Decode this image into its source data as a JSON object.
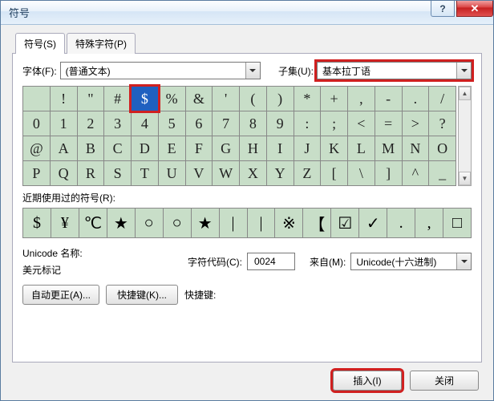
{
  "window": {
    "title": "符号"
  },
  "tabs": {
    "symbols": "符号(S)",
    "special": "特殊字符(P)"
  },
  "font": {
    "label": "字体(F):",
    "value": "(普通文本)"
  },
  "subset": {
    "label": "子集(U):",
    "value": "基本拉丁语"
  },
  "grid_rows": [
    [
      " ",
      "!",
      "\"",
      "#",
      "$",
      "%",
      "&",
      "'",
      "(",
      ")",
      "*",
      "+",
      ",",
      "-",
      ".",
      "/"
    ],
    [
      "0",
      "1",
      "2",
      "3",
      "4",
      "5",
      "6",
      "7",
      "8",
      "9",
      ":",
      ";",
      "<",
      "=",
      ">",
      "?"
    ],
    [
      "@",
      "A",
      "B",
      "C",
      "D",
      "E",
      "F",
      "G",
      "H",
      "I",
      "J",
      "K",
      "L",
      "M",
      "N",
      "O"
    ],
    [
      "P",
      "Q",
      "R",
      "S",
      "T",
      "U",
      "V",
      "W",
      "X",
      "Y",
      "Z",
      "[",
      "\\",
      "]",
      "^",
      "_"
    ]
  ],
  "selected": {
    "row": 0,
    "col": 4
  },
  "recent": {
    "label": "近期使用过的符号(R):",
    "items": [
      "$",
      "¥",
      "℃",
      "★",
      "○",
      "○",
      "★",
      "|",
      "|",
      "※",
      "【",
      "☑",
      "✓",
      ".",
      ",",
      "□"
    ]
  },
  "unicode_name": {
    "label": "Unicode 名称:",
    "value": "美元标记"
  },
  "charcode": {
    "label": "字符代码(C):",
    "value": "0024"
  },
  "from": {
    "label": "来自(M):",
    "value": "Unicode(十六进制)"
  },
  "buttons": {
    "autocorrect": "自动更正(A)...",
    "shortcutkey": "快捷键(K)...",
    "shortcut_label": "快捷键:",
    "shortcut_value": ""
  },
  "footer": {
    "insert": "插入(I)",
    "close": "关闭"
  }
}
